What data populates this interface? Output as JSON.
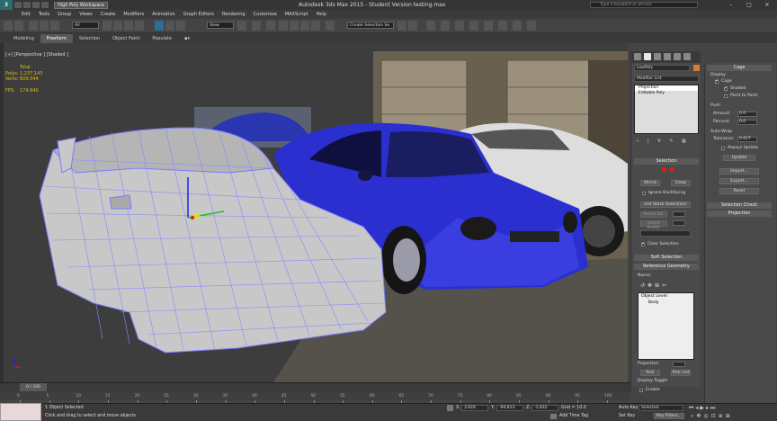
{
  "window": {
    "title": "Autodesk 3ds Max  2015  -  Student Version    testing.max",
    "workspace": "High Poly Workspace",
    "search_placeholder": "Type a keyword or phrase"
  },
  "menu": [
    "Edit",
    "Tools",
    "Group",
    "Views",
    "Create",
    "Modifiers",
    "Animation",
    "Graph Editors",
    "Rendering",
    "Customize",
    "MAXScript",
    "Help"
  ],
  "toolbar": {
    "filter": "All",
    "view": "View",
    "named_selection": "Create Selection Se"
  },
  "ribbon": {
    "tabs": [
      "Modeling",
      "Freeform",
      "Selection",
      "Object Paint",
      "Populate"
    ]
  },
  "viewport": {
    "label": "[+] [Perspective ] [Shaded ]",
    "stats": {
      "total_label": "Total",
      "polys_label": "Polys:",
      "polys": "1,237,143",
      "verts_label": "Verts:",
      "verts": "609,544",
      "fps_label": "FPS:",
      "fps": "174.840"
    }
  },
  "modify_panel": {
    "object_name": "LowPoly",
    "modifier_list": "Modifier List",
    "stack": [
      "Projection",
      "Editable Poly"
    ],
    "selection": {
      "title": "Selection",
      "shrink": "Shrink",
      "grow": "Grow",
      "ignore_backfacing": "Ignore Backfacing",
      "get_stack": "Get Stack Selections",
      "select_sg": "Select SG:",
      "select_matid": "Select MatID:",
      "clear_selection": "Clear Selection"
    },
    "soft_selection": "Soft Selection",
    "reference_geometry": {
      "title": "Reference Geometry",
      "name_label": "Name:",
      "items": [
        "Object Level:",
        "Body"
      ],
      "projection_label": "Projection:",
      "pick": "Pick",
      "pick_list": "Pick List"
    },
    "display_toggle": {
      "title": "Display Toggle",
      "enable": "Enable"
    }
  },
  "cage_panel": {
    "title": "Cage",
    "display": "Display",
    "cage": "Cage",
    "shaded": "Shaded",
    "point_to_point": "Point to Point",
    "push": "Push",
    "amount_label": "Amount:",
    "amount": "0.0",
    "percent_label": "Percent:",
    "percent": "0.0",
    "auto_wrap": "Auto-Wrap",
    "tolerance_label": "Tolerance:",
    "tolerance": "0.627",
    "always_update": "Always Update",
    "update": "Update",
    "import": "Import...",
    "export": "Export...",
    "reset": "Reset",
    "selection_check": "Selection Check",
    "projection": "Projection"
  },
  "timeline": {
    "frame": "0 / 100",
    "ticks": [
      "0",
      "5",
      "10",
      "15",
      "20",
      "25",
      "30",
      "35",
      "40",
      "45",
      "50",
      "55",
      "60",
      "65",
      "70",
      "75",
      "80",
      "85",
      "90",
      "95",
      "100"
    ]
  },
  "status": {
    "selected": "1 Object Selected",
    "hint": "Click and drag to select and move objects",
    "x_label": "X:",
    "x": "3.924",
    "y_label": "Y:",
    "y": "-94.813",
    "z_label": "Z:",
    "z": "-1.632",
    "grid": "Grid = 10.0",
    "add_time_tag": "Add Time Tag",
    "auto_key": "Auto Key",
    "set_key": "Set Key",
    "selected_dd": "Selected",
    "key_filters": "Key Filters..."
  },
  "colors": {
    "accent": "#2a6b6b",
    "car_blue": "#2b2fd0",
    "wireframe": "#8a8aff",
    "stats": "#e0c000"
  }
}
